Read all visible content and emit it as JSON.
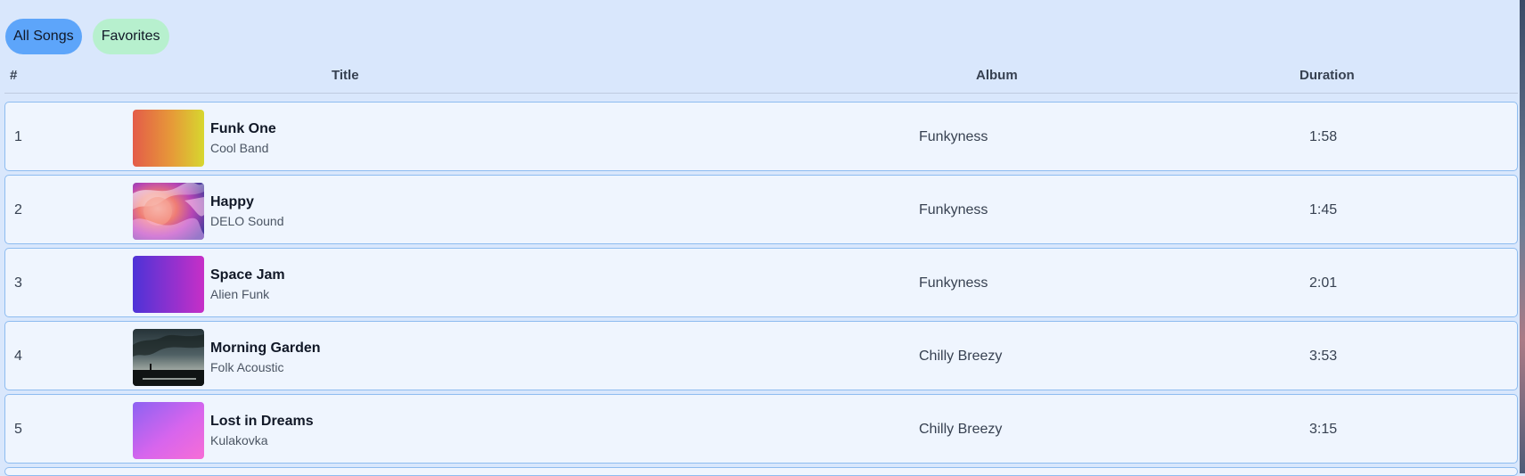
{
  "tabs": [
    {
      "label": "All Songs",
      "active": true,
      "color": "#5da5fa"
    },
    {
      "label": "Favorites",
      "active": false,
      "color": "#b7f0ce"
    }
  ],
  "table": {
    "headers": {
      "number": "#",
      "title": "Title",
      "album": "Album",
      "duration": "Duration"
    }
  },
  "songs": [
    {
      "number": "1",
      "title": "Funk One",
      "artist": "Cool Band",
      "album": "Funkyness",
      "duration": "1:58",
      "cover": "orange-yellow-gradient"
    },
    {
      "number": "2",
      "title": "Happy",
      "artist": "DELO Sound",
      "album": "Funkyness",
      "duration": "1:45",
      "cover": "colorful-blurry-face-photo"
    },
    {
      "number": "3",
      "title": "Space Jam",
      "artist": "Alien Funk",
      "album": "Funkyness",
      "duration": "2:01",
      "cover": "blue-purple-gradient"
    },
    {
      "number": "4",
      "title": "Morning Garden",
      "artist": "Folk Acoustic",
      "album": "Chilly Breezy",
      "duration": "3:53",
      "cover": "dark-cloudy-landscape"
    },
    {
      "number": "5",
      "title": "Lost in Dreams",
      "artist": "Kulakovka",
      "album": "Chilly Breezy",
      "duration": "3:15",
      "cover": "purple-pink-gradient"
    }
  ],
  "colors": {
    "background": "#d9e7fc",
    "row_background": "#eff5fe",
    "row_border": "#8ebcf0",
    "active_tab": "#5da5fa",
    "favorites_tab": "#b7f0ce"
  }
}
